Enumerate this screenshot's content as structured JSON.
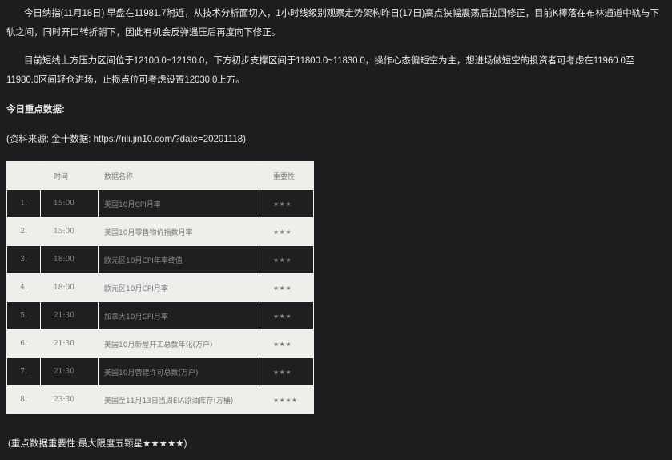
{
  "paragraphs": [
    "今日纳指(11月18日) 早盘在11981.7附近，从技术分析面切入，1小时线级别观察走势架构昨日(17日)高点狭幅震荡后拉回修正，目前K棒落在布林通道中轨与下轨之间，同时开口转折朝下，因此有机会反弹遇压后再度向下修正。",
    "目前短线上方压力区间位于12100.0~12130.0，下方初步支撑区间于11800.0~11830.0，操作心态偏短空为主，想进场做短空的投资者可考虑在11960.0至11980.0区间轻仓进场，止损点位可考虑设置12030.0上方。"
  ],
  "heading": "今日重点数据:",
  "source": "(资料来源: 金十数据: https://rili.jin10.com/?date=20201118)",
  "table": {
    "headers": {
      "index": "",
      "time": "时间",
      "name": "数据名称",
      "importance": "重要性"
    },
    "rows": [
      {
        "index": "1.",
        "time": "15:00",
        "name": "美国10月CPI月率",
        "importance": "★★★"
      },
      {
        "index": "2.",
        "time": "15:00",
        "name": "美国10月零售物价指数月率",
        "importance": "★★★"
      },
      {
        "index": "3.",
        "time": "18:00",
        "name": "欧元区10月CPI年率终值",
        "importance": "★★★"
      },
      {
        "index": "4.",
        "time": "18:00",
        "name": "欧元区10月CPI月率",
        "importance": "★★★"
      },
      {
        "index": "5.",
        "time": "21:30",
        "name": "加拿大10月CPI月率",
        "importance": "★★★"
      },
      {
        "index": "6.",
        "time": "21:30",
        "name": "美国10月新屋开工总数年化(万户)",
        "importance": "★★★"
      },
      {
        "index": "7.",
        "time": "21:30",
        "name": "美国10月营建许可总数(万户)",
        "importance": "★★★"
      },
      {
        "index": "8.",
        "time": "23:30",
        "name": "美国至11月13日当周EIA原油库存(万桶)",
        "importance": "★★★★"
      }
    ]
  },
  "footnote": "(重点数据重要性:最大限度五颗星★★★★★)",
  "colors": {
    "background": "#1d1d1f",
    "row_light": "#f0eeea",
    "row_dark": "#1f1f22"
  }
}
